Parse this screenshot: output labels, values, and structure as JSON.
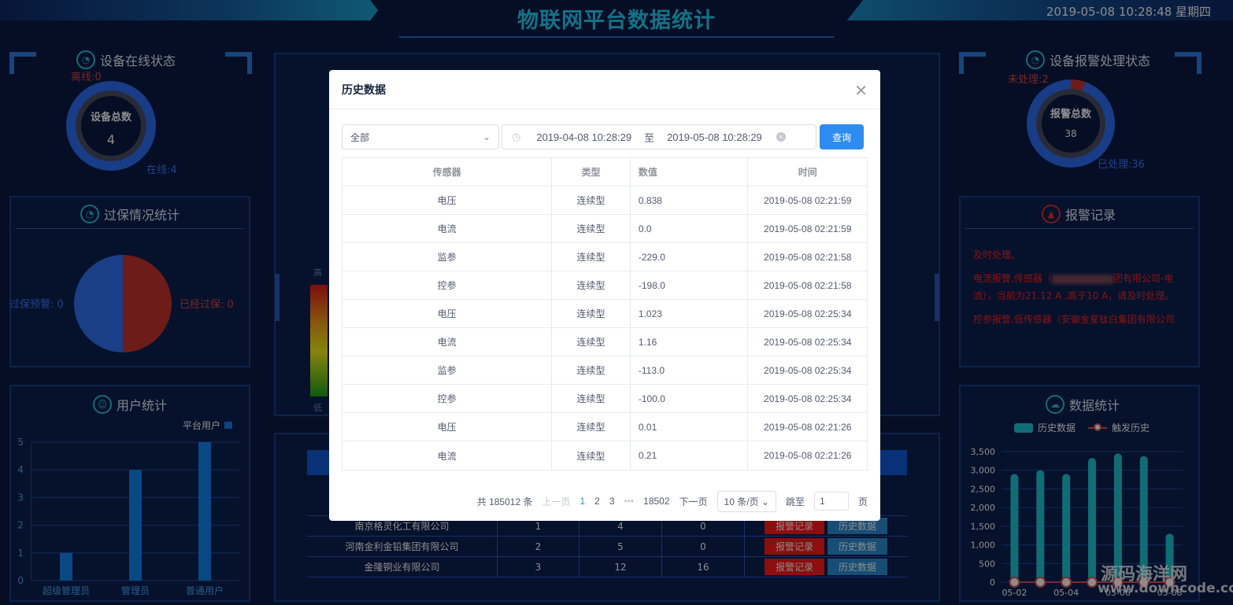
{
  "header": {
    "title": "物联网平台数据统计",
    "datetime": "2019-05-08 10:28:48 星期四"
  },
  "online": {
    "title": "设备在线状态",
    "center_label": "设备总数",
    "total": "4",
    "offline": "离线:0",
    "online": "在线:4"
  },
  "overload": {
    "title": "过保情况统计",
    "warn": "过保预警: 0",
    "done": "已经过保: 0"
  },
  "users": {
    "title": "用户统计",
    "legend": "平台用户"
  },
  "alarm_status": {
    "title": "设备报警处理状态",
    "center_label": "报警总数",
    "total": "38",
    "unhandled": "未处理:2",
    "handled": "已处理:36"
  },
  "alarm_records": {
    "title": "报警记录",
    "lines": [
      "及时处理。",
      "电流报警,传感器（",
      "团有限公司-电",
      "流），当前为21.12 A ,高于10 A，请及时处理。",
      "控参报警,低传感器（安徽金星钛白集团有限公司"
    ]
  },
  "data_stats": {
    "title": "数据统计",
    "legend_bar": "历史数据",
    "legend_line": "触发历史"
  },
  "gauge": {
    "high": "高",
    "low": "低"
  },
  "company_table": {
    "rows": [
      {
        "name": "南京格灵化工有限公司",
        "a": "1",
        "b": "4",
        "c": "0"
      },
      {
        "name": "河南金利金铅集团有限公司",
        "a": "2",
        "b": "5",
        "c": "0"
      },
      {
        "name": "金隆铜业有限公司",
        "a": "3",
        "b": "12",
        "c": "16"
      }
    ],
    "btn_alarm": "报警记录",
    "btn_history": "历史数据"
  },
  "modal": {
    "title": "历史数据",
    "select_value": "全部",
    "date_start": "2019-04-08 10:28:29",
    "date_sep": "至",
    "date_end": "2019-05-08 10:28:29",
    "query": "查询",
    "headers": [
      "传感器",
      "类型",
      "数值",
      "时间"
    ],
    "rows": [
      [
        "电压",
        "连续型",
        "0.838",
        "2019-05-08 02:21:59"
      ],
      [
        "电流",
        "连续型",
        "0.0",
        "2019-05-08 02:21:59"
      ],
      [
        "监参",
        "连续型",
        "-229.0",
        "2019-05-08 02:21:58"
      ],
      [
        "控参",
        "连续型",
        "-198.0",
        "2019-05-08 02:21:58"
      ],
      [
        "电压",
        "连续型",
        "1.023",
        "2019-05-08 02:25:34"
      ],
      [
        "电流",
        "连续型",
        "1.16",
        "2019-05-08 02:25:34"
      ],
      [
        "监参",
        "连续型",
        "-113.0",
        "2019-05-08 02:25:34"
      ],
      [
        "控参",
        "连续型",
        "-100.0",
        "2019-05-08 02:25:34"
      ],
      [
        "电压",
        "连续型",
        "0.01",
        "2019-05-08 02:21:26"
      ],
      [
        "电流",
        "连续型",
        "0.21",
        "2019-05-08 02:21:26"
      ]
    ],
    "pager": {
      "total": "共 185012 条",
      "prev": "上一页",
      "pages": [
        "1",
        "2",
        "3"
      ],
      "ellipsis": "•••",
      "last": "18502",
      "next": "下一页",
      "size": "10 条/页",
      "jump": "跳至",
      "jump_value": "1",
      "page_unit": "页"
    }
  },
  "watermark": {
    "line1": "源码海洋网",
    "line2": "www.downcode.com"
  },
  "chart_data": [
    {
      "type": "bar",
      "categories": [
        "超级管理员",
        "管理员",
        "普通用户"
      ],
      "series": [
        {
          "name": "平台用户",
          "values": [
            1,
            4,
            5
          ]
        }
      ],
      "ylim": [
        0,
        5
      ],
      "yticks": [
        "0",
        "1",
        "2",
        "3",
        "4",
        "5"
      ]
    },
    {
      "type": "bar",
      "x_labels": [
        "05-02",
        "05-04",
        "05-06",
        "05-08"
      ],
      "series": [
        {
          "name": "历史数据",
          "values": [
            2900,
            3000,
            2900,
            3330,
            3450,
            3380,
            1300
          ]
        },
        {
          "name": "触发历史",
          "values": [
            0,
            0,
            0,
            0,
            0,
            0,
            0
          ]
        }
      ],
      "ylim": [
        0,
        3500
      ],
      "yticks": [
        "0",
        "500",
        "1,000",
        "1,500",
        "2,000",
        "2,500",
        "3,000",
        "3,500"
      ]
    },
    {
      "type": "pie",
      "labels": [
        "过保预警",
        "已经过保"
      ],
      "values": [
        0,
        0
      ]
    }
  ]
}
